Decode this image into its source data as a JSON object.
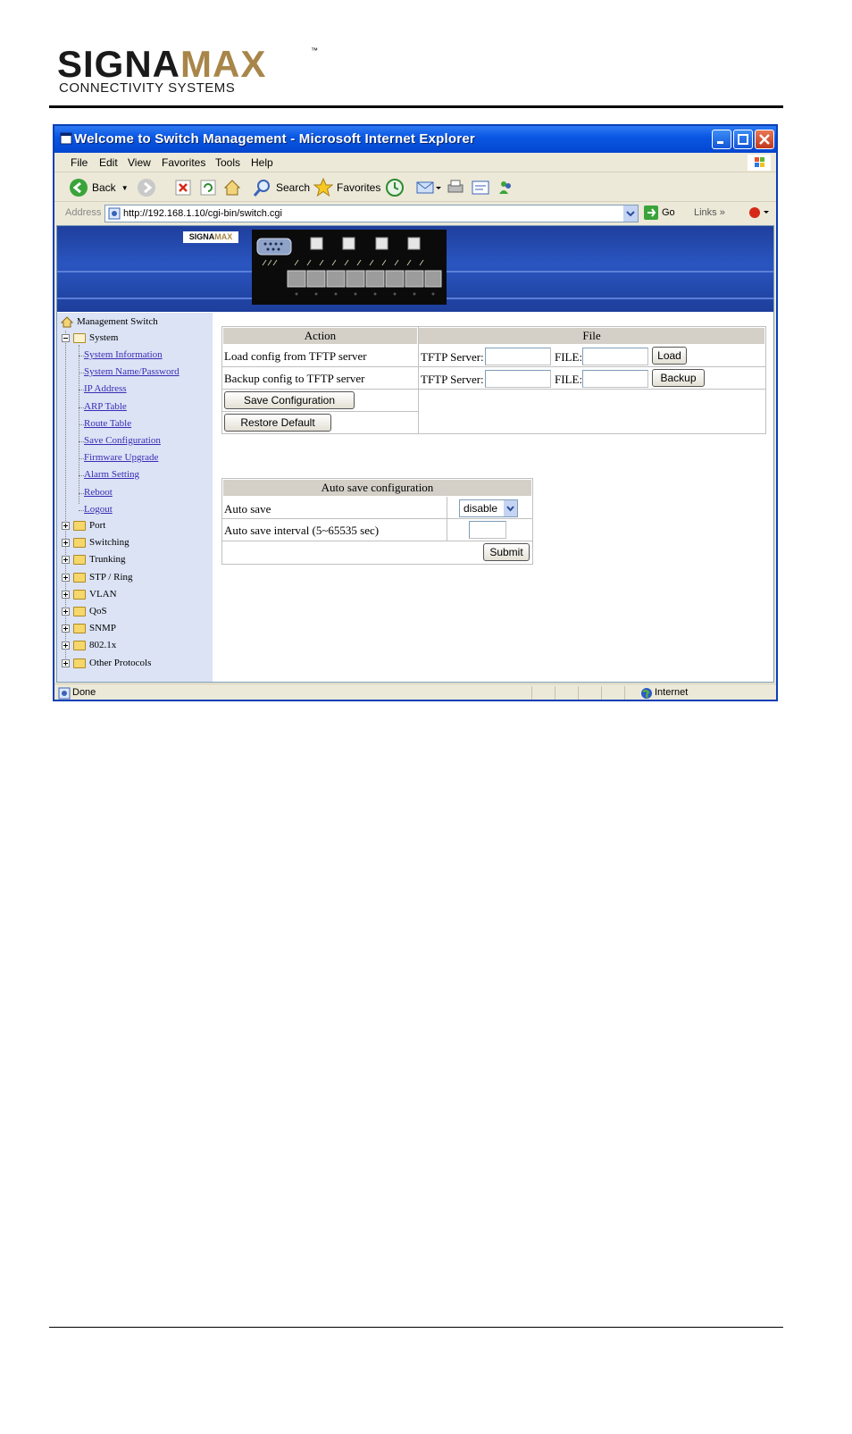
{
  "manual": {
    "logo_brand_a": "SIGNA",
    "logo_brand_b": "MAX",
    "logo_tm": "™",
    "logo_tagline": "CONNECTIVITY SYSTEMS"
  },
  "window": {
    "title": "Welcome to Switch Management - Microsoft Internet Explorer"
  },
  "menubar": [
    "File",
    "Edit",
    "View",
    "Favorites",
    "Tools",
    "Help"
  ],
  "toolbar": {
    "back": "Back",
    "search": "Search",
    "favorites": "Favorites"
  },
  "addressbar": {
    "label": "Address",
    "url": "http://192.168.1.10/cgi-bin/switch.cgi",
    "go": "Go",
    "links": "Links"
  },
  "banner": {
    "mini_logo_a": "SIGNA",
    "mini_logo_b": "MAX"
  },
  "tree": {
    "root": "Management Switch",
    "system": "System",
    "system_items": [
      "System Information",
      "System Name/Password",
      "IP Address",
      "ARP Table",
      "Route Table",
      "Save Configuration",
      "Firmware Upgrade",
      "Alarm Setting",
      "Reboot",
      "Logout"
    ],
    "folders": [
      "Port",
      "Switching",
      "Trunking",
      "STP / Ring",
      "VLAN",
      "QoS",
      "SNMP",
      "802.1x",
      "Other Protocols"
    ]
  },
  "config_table": {
    "header_action": "Action",
    "header_file": "File",
    "load_label": "Load config from TFTP server",
    "backup_label": "Backup config to TFTP server",
    "tftp_server_label": "TFTP Server:",
    "file_label": "FILE:",
    "load_button": "Load",
    "backup_button": "Backup",
    "save_button": "Save Configuration",
    "restore_button": "Restore Default"
  },
  "autosave_table": {
    "header": "Auto save configuration",
    "auto_save_label": "Auto save",
    "auto_save_value": "disable",
    "interval_label": "Auto save interval (5~65535 sec)",
    "interval_value": "",
    "submit_button": "Submit"
  },
  "statusbar": {
    "status": "Done",
    "zone": "Internet"
  },
  "colors": {
    "titlebar": "#0a58e4",
    "tree_bg": "#dbe3f5",
    "link": "#3b2cb5",
    "table_header": "#d4d0c8",
    "brand_gold": "#a8864a"
  }
}
